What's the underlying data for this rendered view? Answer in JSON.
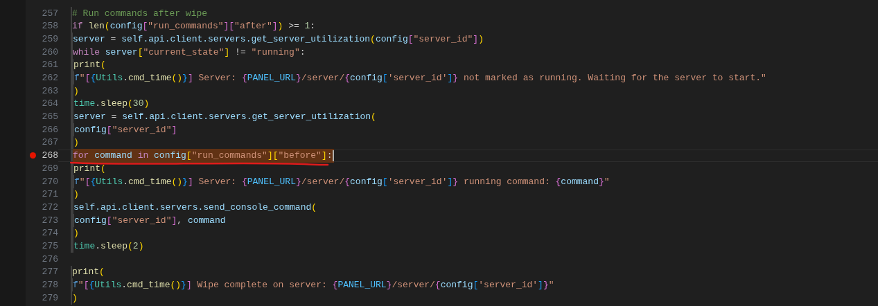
{
  "lines": [
    {
      "number": "257",
      "selected": false,
      "breakpoint": false,
      "underlined": false,
      "tokens": [
        {
          "kind": "comment",
          "text": "        # Run commands after wipe"
        }
      ]
    },
    {
      "number": "258",
      "selected": false,
      "breakpoint": false,
      "underlined": false,
      "tokens": [
        {
          "kind": "keyword",
          "text": "        if"
        },
        {
          "kind": "function",
          "text": " len"
        },
        {
          "kind": "bracket1",
          "text": "("
        },
        {
          "kind": "variable",
          "text": "config"
        },
        {
          "kind": "bracket2",
          "text": "["
        },
        {
          "kind": "string",
          "text": "\"run_commands\""
        },
        {
          "kind": "bracket2",
          "text": "]["
        },
        {
          "kind": "string",
          "text": "\"after\""
        },
        {
          "kind": "bracket2",
          "text": "]"
        },
        {
          "kind": "bracket1",
          "text": ")"
        },
        {
          "kind": "plain",
          "text": " >= "
        },
        {
          "kind": "number",
          "text": "1"
        },
        {
          "kind": "plain",
          "text": ":"
        }
      ]
    },
    {
      "number": "259",
      "selected": false,
      "breakpoint": false,
      "underlined": false,
      "tokens": [
        {
          "kind": "variable",
          "text": "            server"
        },
        {
          "kind": "plain",
          "text": " = "
        },
        {
          "kind": "variable",
          "text": "self.api.client.servers.get_server_utilization"
        },
        {
          "kind": "bracket1",
          "text": "("
        },
        {
          "kind": "variable",
          "text": "config"
        },
        {
          "kind": "bracket2",
          "text": "["
        },
        {
          "kind": "string",
          "text": "\"server_id\""
        },
        {
          "kind": "bracket2",
          "text": "]"
        },
        {
          "kind": "bracket1",
          "text": ")"
        }
      ]
    },
    {
      "number": "260",
      "selected": false,
      "breakpoint": false,
      "underlined": false,
      "tokens": [
        {
          "kind": "keyword",
          "text": "            while"
        },
        {
          "kind": "variable",
          "text": " server"
        },
        {
          "kind": "bracket1",
          "text": "["
        },
        {
          "kind": "string",
          "text": "\"current_state\""
        },
        {
          "kind": "bracket1",
          "text": "]"
        },
        {
          "kind": "plain",
          "text": " != "
        },
        {
          "kind": "string",
          "text": "\"running\""
        },
        {
          "kind": "plain",
          "text": ":"
        }
      ]
    },
    {
      "number": "261",
      "selected": false,
      "breakpoint": false,
      "underlined": false,
      "tokens": [
        {
          "kind": "function",
          "text": "                print"
        },
        {
          "kind": "bracket1",
          "text": "("
        }
      ]
    },
    {
      "number": "262",
      "selected": false,
      "breakpoint": false,
      "underlined": false,
      "tokens": [
        {
          "kind": "prefix",
          "text": "                    f"
        },
        {
          "kind": "string",
          "text": "\""
        },
        {
          "kind": "bracket2",
          "text": "["
        },
        {
          "kind": "bracket3",
          "text": "{"
        },
        {
          "kind": "class",
          "text": "Utils"
        },
        {
          "kind": "plain",
          "text": "."
        },
        {
          "kind": "function",
          "text": "cmd_time"
        },
        {
          "kind": "bracket1",
          "text": "()"
        },
        {
          "kind": "bracket3",
          "text": "}"
        },
        {
          "kind": "bracket2",
          "text": "]"
        },
        {
          "kind": "string",
          "text": " Server: "
        },
        {
          "kind": "bracket2",
          "text": "{"
        },
        {
          "kind": "constant",
          "text": "PANEL_URL"
        },
        {
          "kind": "bracket2",
          "text": "}"
        },
        {
          "kind": "string",
          "text": "/server/"
        },
        {
          "kind": "bracket2",
          "text": "{"
        },
        {
          "kind": "variable",
          "text": "config"
        },
        {
          "kind": "bracket3",
          "text": "["
        },
        {
          "kind": "string",
          "text": "'server_id'"
        },
        {
          "kind": "bracket3",
          "text": "]"
        },
        {
          "kind": "bracket2",
          "text": "}"
        },
        {
          "kind": "string",
          "text": " not marked as running. Waiting for the server to start.\""
        }
      ]
    },
    {
      "number": "263",
      "selected": false,
      "breakpoint": false,
      "underlined": false,
      "tokens": [
        {
          "kind": "bracket1",
          "text": "                )"
        }
      ]
    },
    {
      "number": "264",
      "selected": false,
      "breakpoint": false,
      "underlined": false,
      "tokens": [
        {
          "kind": "class",
          "text": "                time"
        },
        {
          "kind": "plain",
          "text": "."
        },
        {
          "kind": "function",
          "text": "sleep"
        },
        {
          "kind": "bracket1",
          "text": "("
        },
        {
          "kind": "number",
          "text": "30"
        },
        {
          "kind": "bracket1",
          "text": ")"
        }
      ]
    },
    {
      "number": "265",
      "selected": false,
      "breakpoint": false,
      "underlined": false,
      "tokens": [
        {
          "kind": "variable",
          "text": "                server"
        },
        {
          "kind": "plain",
          "text": " = "
        },
        {
          "kind": "variable",
          "text": "self.api.client.servers.get_server_utilization"
        },
        {
          "kind": "bracket1",
          "text": "("
        }
      ]
    },
    {
      "number": "266",
      "selected": false,
      "breakpoint": false,
      "underlined": false,
      "tokens": [
        {
          "kind": "variable",
          "text": "                    config"
        },
        {
          "kind": "bracket2",
          "text": "["
        },
        {
          "kind": "string",
          "text": "\"server_id\""
        },
        {
          "kind": "bracket2",
          "text": "]"
        }
      ]
    },
    {
      "number": "267",
      "selected": false,
      "breakpoint": false,
      "underlined": false,
      "tokens": [
        {
          "kind": "bracket1",
          "text": "                )"
        }
      ]
    },
    {
      "number": "268",
      "selected": true,
      "breakpoint": true,
      "underlined": true,
      "tokens": [
        {
          "kind": "keyword",
          "text": "            for"
        },
        {
          "kind": "variable",
          "text": " command"
        },
        {
          "kind": "keyword",
          "text": " in"
        },
        {
          "kind": "variable",
          "text": " config"
        },
        {
          "kind": "bracket1",
          "text": "["
        },
        {
          "kind": "string",
          "text": "\"run_commands\""
        },
        {
          "kind": "bracket1",
          "text": "]["
        },
        {
          "kind": "string",
          "text": "\"before\""
        },
        {
          "kind": "bracket1",
          "text": "]"
        },
        {
          "kind": "plain",
          "text": ":"
        }
      ]
    },
    {
      "number": "269",
      "selected": false,
      "breakpoint": false,
      "underlined": false,
      "tokens": [
        {
          "kind": "function",
          "text": "                print"
        },
        {
          "kind": "bracket1",
          "text": "("
        }
      ]
    },
    {
      "number": "270",
      "selected": false,
      "breakpoint": false,
      "underlined": false,
      "tokens": [
        {
          "kind": "prefix",
          "text": "                    f"
        },
        {
          "kind": "string",
          "text": "\""
        },
        {
          "kind": "bracket2",
          "text": "["
        },
        {
          "kind": "bracket3",
          "text": "{"
        },
        {
          "kind": "class",
          "text": "Utils"
        },
        {
          "kind": "plain",
          "text": "."
        },
        {
          "kind": "function",
          "text": "cmd_time"
        },
        {
          "kind": "bracket1",
          "text": "()"
        },
        {
          "kind": "bracket3",
          "text": "}"
        },
        {
          "kind": "bracket2",
          "text": "]"
        },
        {
          "kind": "string",
          "text": " Server: "
        },
        {
          "kind": "bracket2",
          "text": "{"
        },
        {
          "kind": "constant",
          "text": "PANEL_URL"
        },
        {
          "kind": "bracket2",
          "text": "}"
        },
        {
          "kind": "string",
          "text": "/server/"
        },
        {
          "kind": "bracket2",
          "text": "{"
        },
        {
          "kind": "variable",
          "text": "config"
        },
        {
          "kind": "bracket3",
          "text": "["
        },
        {
          "kind": "string",
          "text": "'server_id'"
        },
        {
          "kind": "bracket3",
          "text": "]"
        },
        {
          "kind": "bracket2",
          "text": "}"
        },
        {
          "kind": "string",
          "text": " running command: "
        },
        {
          "kind": "bracket2",
          "text": "{"
        },
        {
          "kind": "variable",
          "text": "command"
        },
        {
          "kind": "bracket2",
          "text": "}"
        },
        {
          "kind": "string",
          "text": "\""
        }
      ]
    },
    {
      "number": "271",
      "selected": false,
      "breakpoint": false,
      "underlined": false,
      "tokens": [
        {
          "kind": "bracket1",
          "text": "                )"
        }
      ]
    },
    {
      "number": "272",
      "selected": false,
      "breakpoint": false,
      "underlined": false,
      "tokens": [
        {
          "kind": "variable",
          "text": "                self.api.client.servers.send_console_command"
        },
        {
          "kind": "bracket1",
          "text": "("
        }
      ]
    },
    {
      "number": "273",
      "selected": false,
      "breakpoint": false,
      "underlined": false,
      "tokens": [
        {
          "kind": "variable",
          "text": "                    config"
        },
        {
          "kind": "bracket2",
          "text": "["
        },
        {
          "kind": "string",
          "text": "\"server_id\""
        },
        {
          "kind": "bracket2",
          "text": "]"
        },
        {
          "kind": "plain",
          "text": ", "
        },
        {
          "kind": "variable",
          "text": "command"
        }
      ]
    },
    {
      "number": "274",
      "selected": false,
      "breakpoint": false,
      "underlined": false,
      "tokens": [
        {
          "kind": "bracket1",
          "text": "                )"
        }
      ]
    },
    {
      "number": "275",
      "selected": false,
      "breakpoint": false,
      "underlined": false,
      "tokens": [
        {
          "kind": "class",
          "text": "                time"
        },
        {
          "kind": "plain",
          "text": "."
        },
        {
          "kind": "function",
          "text": "sleep"
        },
        {
          "kind": "bracket1",
          "text": "("
        },
        {
          "kind": "number",
          "text": "2"
        },
        {
          "kind": "bracket1",
          "text": ")"
        }
      ]
    },
    {
      "number": "276",
      "selected": false,
      "breakpoint": false,
      "underlined": false
    },
    {
      "number": "277",
      "selected": false,
      "breakpoint": false,
      "underlined": false,
      "tokens": [
        {
          "kind": "function",
          "text": "        print"
        },
        {
          "kind": "bracket1",
          "text": "("
        }
      ]
    },
    {
      "number": "278",
      "selected": false,
      "breakpoint": false,
      "underlined": false,
      "tokens": [
        {
          "kind": "prefix",
          "text": "            f"
        },
        {
          "kind": "string",
          "text": "\""
        },
        {
          "kind": "bracket2",
          "text": "["
        },
        {
          "kind": "bracket3",
          "text": "{"
        },
        {
          "kind": "class",
          "text": "Utils"
        },
        {
          "kind": "plain",
          "text": "."
        },
        {
          "kind": "function",
          "text": "cmd_time"
        },
        {
          "kind": "bracket1",
          "text": "()"
        },
        {
          "kind": "bracket3",
          "text": "}"
        },
        {
          "kind": "bracket2",
          "text": "]"
        },
        {
          "kind": "string",
          "text": " Wipe complete on server: "
        },
        {
          "kind": "bracket2",
          "text": "{"
        },
        {
          "kind": "constant",
          "text": "PANEL_URL"
        },
        {
          "kind": "bracket2",
          "text": "}"
        },
        {
          "kind": "string",
          "text": "/server/"
        },
        {
          "kind": "bracket2",
          "text": "{"
        },
        {
          "kind": "variable",
          "text": "config"
        },
        {
          "kind": "bracket3",
          "text": "["
        },
        {
          "kind": "string",
          "text": "'server_id'"
        },
        {
          "kind": "bracket3",
          "text": "]"
        },
        {
          "kind": "bracket2",
          "text": "}"
        },
        {
          "kind": "string",
          "text": "\""
        }
      ]
    },
    {
      "number": "279",
      "selected": false,
      "breakpoint": false,
      "underlined": false,
      "tokens": [
        {
          "kind": "bracket1",
          "text": "        )"
        }
      ]
    }
  ]
}
